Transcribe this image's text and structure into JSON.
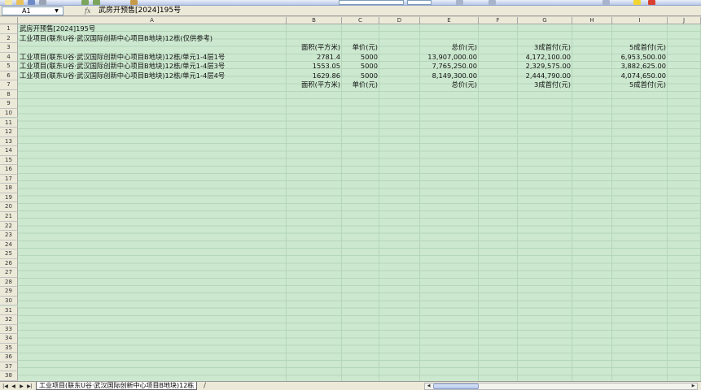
{
  "formula_bar": {
    "cell_ref": "A1",
    "fx_label": "fx",
    "content": "武房开预售[2024]195号"
  },
  "columns": [
    "A",
    "B",
    "C",
    "D",
    "E",
    "F",
    "G",
    "H",
    "I",
    "J"
  ],
  "rows": [
    "1",
    "2",
    "3",
    "4",
    "5",
    "6",
    "7",
    "8",
    "9",
    "10",
    "11",
    "12",
    "13",
    "14",
    "15",
    "16",
    "17",
    "18",
    "19",
    "20",
    "21",
    "22",
    "23",
    "24",
    "25",
    "26",
    "27",
    "28",
    "29",
    "30",
    "31",
    "32",
    "33",
    "34",
    "35",
    "36",
    "37",
    "38"
  ],
  "sheet": {
    "r1": {
      "a": "武房开预售[2024]195号"
    },
    "r2": {
      "a": "工业项目(联东U谷·武汉国际创新中心项目B地块)12栋(仅供参考)"
    },
    "r3": {
      "b": "面积(平方米)",
      "c": "单价(元)",
      "e": "总价(元)",
      "g": "3成首付(元)",
      "i": "5成首付(元)"
    },
    "r4": {
      "a": "工业项目(联东U谷·武汉国际创新中心项目B地块)12栋/单元1-4层1号",
      "b": "2781.4",
      "c": "5000",
      "e": "13,907,000.00",
      "g": "4,172,100.00",
      "i": "6,953,500.00"
    },
    "r5": {
      "a": "工业项目(联东U谷·武汉国际创新中心项目B地块)12栋/单元1-4层3号",
      "b": "1553.05",
      "c": "5000",
      "e": "7,765,250.00",
      "g": "2,329,575.00",
      "i": "3,882,625.00"
    },
    "r6": {
      "a": "工业项目(联东U谷·武汉国际创新中心项目B地块)12栋/单元1-4层4号",
      "b": "1629.86",
      "c": "5000",
      "e": "8,149,300.00",
      "g": "2,444,790.00",
      "i": "4,074,650.00"
    },
    "r7": {
      "b": "面积(平方米)",
      "c": "单价(元)",
      "e": "总价(元)",
      "g": "3成首付(元)",
      "i": "5成首付(元)"
    }
  },
  "tabs": {
    "nav": [
      "|◀",
      "◀",
      "▶",
      "▶|"
    ],
    "active": "工业项目(联东U谷·武汉国际创新中心项目B地块)12栋",
    "tail": "/"
  },
  "colors": {
    "grid_bg": "#cce8cf",
    "header_bg": "#ece9d8"
  }
}
